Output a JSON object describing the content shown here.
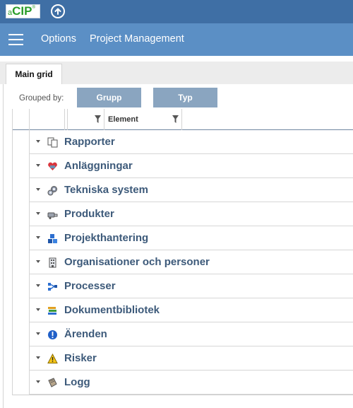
{
  "app": {
    "logo": {
      "prefix": "a",
      "name": "CIP",
      "mark": "®"
    },
    "up_button_icon": "arrow-up-circle-icon",
    "colors": {
      "topbar": "#3f6fa5",
      "menubar": "#5b8fc5",
      "group_chip": "#8aa5c0",
      "row_text": "#3d5a7a"
    }
  },
  "menubar": {
    "menu_icon": "hamburger-icon",
    "items": [
      {
        "label": "Options"
      },
      {
        "label": "Project Management"
      }
    ]
  },
  "tabs": [
    {
      "label": "Main grid",
      "active": true
    }
  ],
  "grid": {
    "grouped_by_label": "Grouped by:",
    "group_chips": [
      {
        "label": "Grupp"
      },
      {
        "label": "Typ"
      }
    ],
    "columns": [
      {
        "label": ""
      },
      {
        "label": ""
      },
      {
        "label": ""
      },
      {
        "label": "",
        "filter_icon": "filter-icon"
      },
      {
        "label": "Element",
        "filter_icon": "filter-icon"
      }
    ],
    "groups": [
      {
        "label": "Rapporter",
        "icon": "reports-icon"
      },
      {
        "label": "Anläggningar",
        "icon": "facilities-icon"
      },
      {
        "label": "Tekniska system",
        "icon": "gears-icon"
      },
      {
        "label": "Produkter",
        "icon": "products-icon"
      },
      {
        "label": "Projekthantering",
        "icon": "project-blocks-icon"
      },
      {
        "label": "Organisationer och personer",
        "icon": "building-icon"
      },
      {
        "label": "Processer",
        "icon": "process-flow-icon"
      },
      {
        "label": "Dokumentbibliotek",
        "icon": "books-icon"
      },
      {
        "label": "Ärenden",
        "icon": "exclamation-icon"
      },
      {
        "label": "Risker",
        "icon": "warning-icon"
      },
      {
        "label": "Logg",
        "icon": "logbook-icon"
      }
    ]
  }
}
